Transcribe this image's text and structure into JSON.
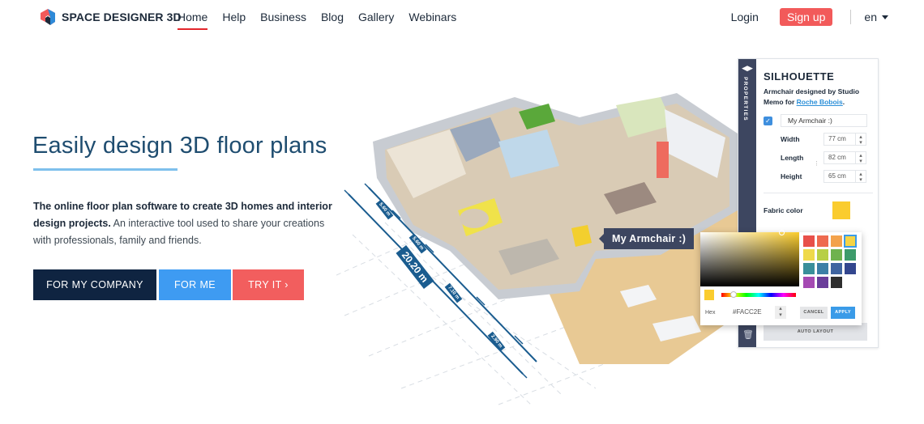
{
  "nav": {
    "brand": "SPACE DESIGNER 3D",
    "links": [
      {
        "label": "Home",
        "active": true
      },
      {
        "label": "Help",
        "active": false
      },
      {
        "label": "Business",
        "active": false
      },
      {
        "label": "Blog",
        "active": false
      },
      {
        "label": "Gallery",
        "active": false
      },
      {
        "label": "Webinars",
        "active": false
      }
    ],
    "login": "Login",
    "signup": "Sign up",
    "language": "en"
  },
  "hero": {
    "title": "Easily design 3D floor plans",
    "desc_bold": "The online floor plan software to create 3D homes and interior design projects.",
    "desc_rest": " An interactive tool used to share your creations with professionals, family and friends.",
    "cta_company": "FOR MY COMPANY",
    "cta_me": "FOR ME",
    "cta_try": "TRY IT ›"
  },
  "scene": {
    "tooltip": "My Armchair :)",
    "dimensions": {
      "total": "20.20 m",
      "segments": [
        "5.60 m",
        "5.60 m",
        "7.10 m",
        "2.90 m"
      ]
    }
  },
  "panel": {
    "side_label": "PROPERTIES",
    "title": "SILHOUETTE",
    "subtitle": "Armchair designed by Studio Memo for ",
    "subtitle_link": "Roche Bobois",
    "subtitle_end": ".",
    "name_checked": true,
    "name_value": "My Armchair :)",
    "dims": [
      {
        "label": "Width",
        "value": "77 cm"
      },
      {
        "label": "Length",
        "value": "82 cm"
      },
      {
        "label": "Height",
        "value": "65 cm"
      }
    ],
    "fabric_label": "Fabric color",
    "fabric_color": "#FACC2E",
    "auto_layout": "AUTO LAYOUT"
  },
  "color_picker": {
    "hex_label": "Hex",
    "hex_value": "#FACC2E",
    "cancel": "CANCEL",
    "apply": "APPLY",
    "palette": [
      "#e8504a",
      "#ee6a4f",
      "#f3a24b",
      "#f5d445",
      "#efd94a",
      "#b8cf45",
      "#6fb24e",
      "#3d9b6b",
      "#3a8f9a",
      "#3c7fa6",
      "#3f64a0",
      "#33468e",
      "#a54ab3",
      "#6a3d9a",
      "#2e2e2e"
    ],
    "selected_index": 3
  }
}
